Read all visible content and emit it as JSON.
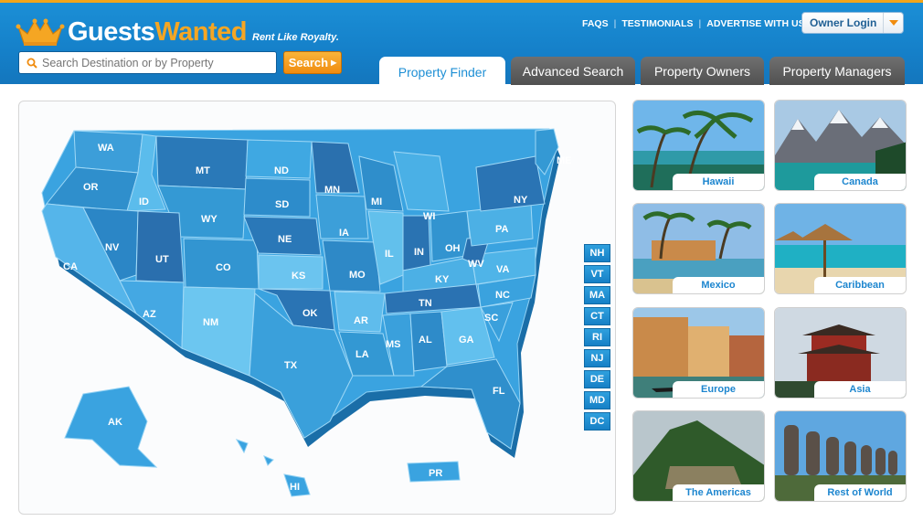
{
  "brand": {
    "name_part1": "Guests",
    "name_part2": "Wanted",
    "tagline": "Rent Like Royalty."
  },
  "search": {
    "placeholder": "Search Destination or by Property",
    "button_label": "Search"
  },
  "top_links": [
    "FAQS",
    "TESTIMONIALS",
    "ADVERTISE WITH US"
  ],
  "owner_login": {
    "label": "Owner Login"
  },
  "tabs": [
    {
      "label": "Property Finder",
      "active": true
    },
    {
      "label": "Advanced Search",
      "active": false
    },
    {
      "label": "Property Owners",
      "active": false
    },
    {
      "label": "Property Managers",
      "active": false
    }
  ],
  "map": {
    "state_labels": [
      "WA",
      "OR",
      "CA",
      "ID",
      "NV",
      "MT",
      "WY",
      "UT",
      "AZ",
      "CO",
      "NM",
      "ND",
      "SD",
      "NE",
      "KS",
      "OK",
      "TX",
      "MN",
      "IA",
      "MO",
      "AR",
      "LA",
      "WI",
      "IL",
      "MI",
      "IN",
      "OH",
      "KY",
      "TN",
      "MS",
      "AL",
      "GA",
      "FL",
      "SC",
      "NC",
      "VA",
      "WV",
      "PA",
      "NY",
      "ME",
      "AK",
      "HI",
      "PR"
    ],
    "northeast_buttons": [
      "NH",
      "VT",
      "MA",
      "CT",
      "RI",
      "NJ",
      "DE",
      "MD",
      "DC"
    ]
  },
  "destinations": [
    {
      "name": "Hawaii"
    },
    {
      "name": "Canada"
    },
    {
      "name": "Mexico"
    },
    {
      "name": "Caribbean"
    },
    {
      "name": "Europe"
    },
    {
      "name": "Asia"
    },
    {
      "name": "The Americas"
    },
    {
      "name": "Rest of World"
    }
  ],
  "colors": {
    "header_blue": "#1580c9",
    "accent_orange": "#f5a623",
    "tab_active_text": "#1e8fd5",
    "caption_blue": "#1d86cf"
  }
}
